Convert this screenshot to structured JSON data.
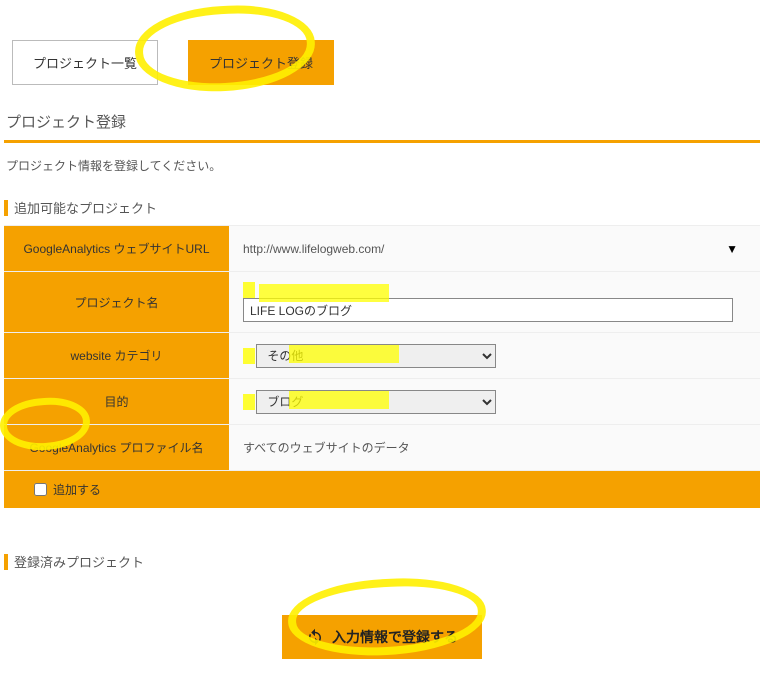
{
  "tabs": {
    "list": "プロジェクト一覧",
    "register": "プロジェクト登録"
  },
  "page": {
    "title": "プロジェクト登録",
    "helper": "プロジェクト情報を登録してください。"
  },
  "section_addable": "追加可能なプロジェクト",
  "section_added": "登録済みプロジェクト",
  "form": {
    "url": {
      "label": "GoogleAnalytics ウェブサイトURL",
      "value": "http://www.lifelogweb.com/"
    },
    "name": {
      "label": "プロジェクト名",
      "value": "LIFE LOGのブログ"
    },
    "category": {
      "label": "website カテゴリ",
      "value": "その他"
    },
    "purpose": {
      "label": "目的",
      "value": "ブログ"
    },
    "profile": {
      "label": "GoogleAnalytics プロファイル名",
      "value": "すべてのウェブサイトのデータ"
    },
    "add_label": "追加する"
  },
  "submit": {
    "label": "入力情報で登録する"
  }
}
